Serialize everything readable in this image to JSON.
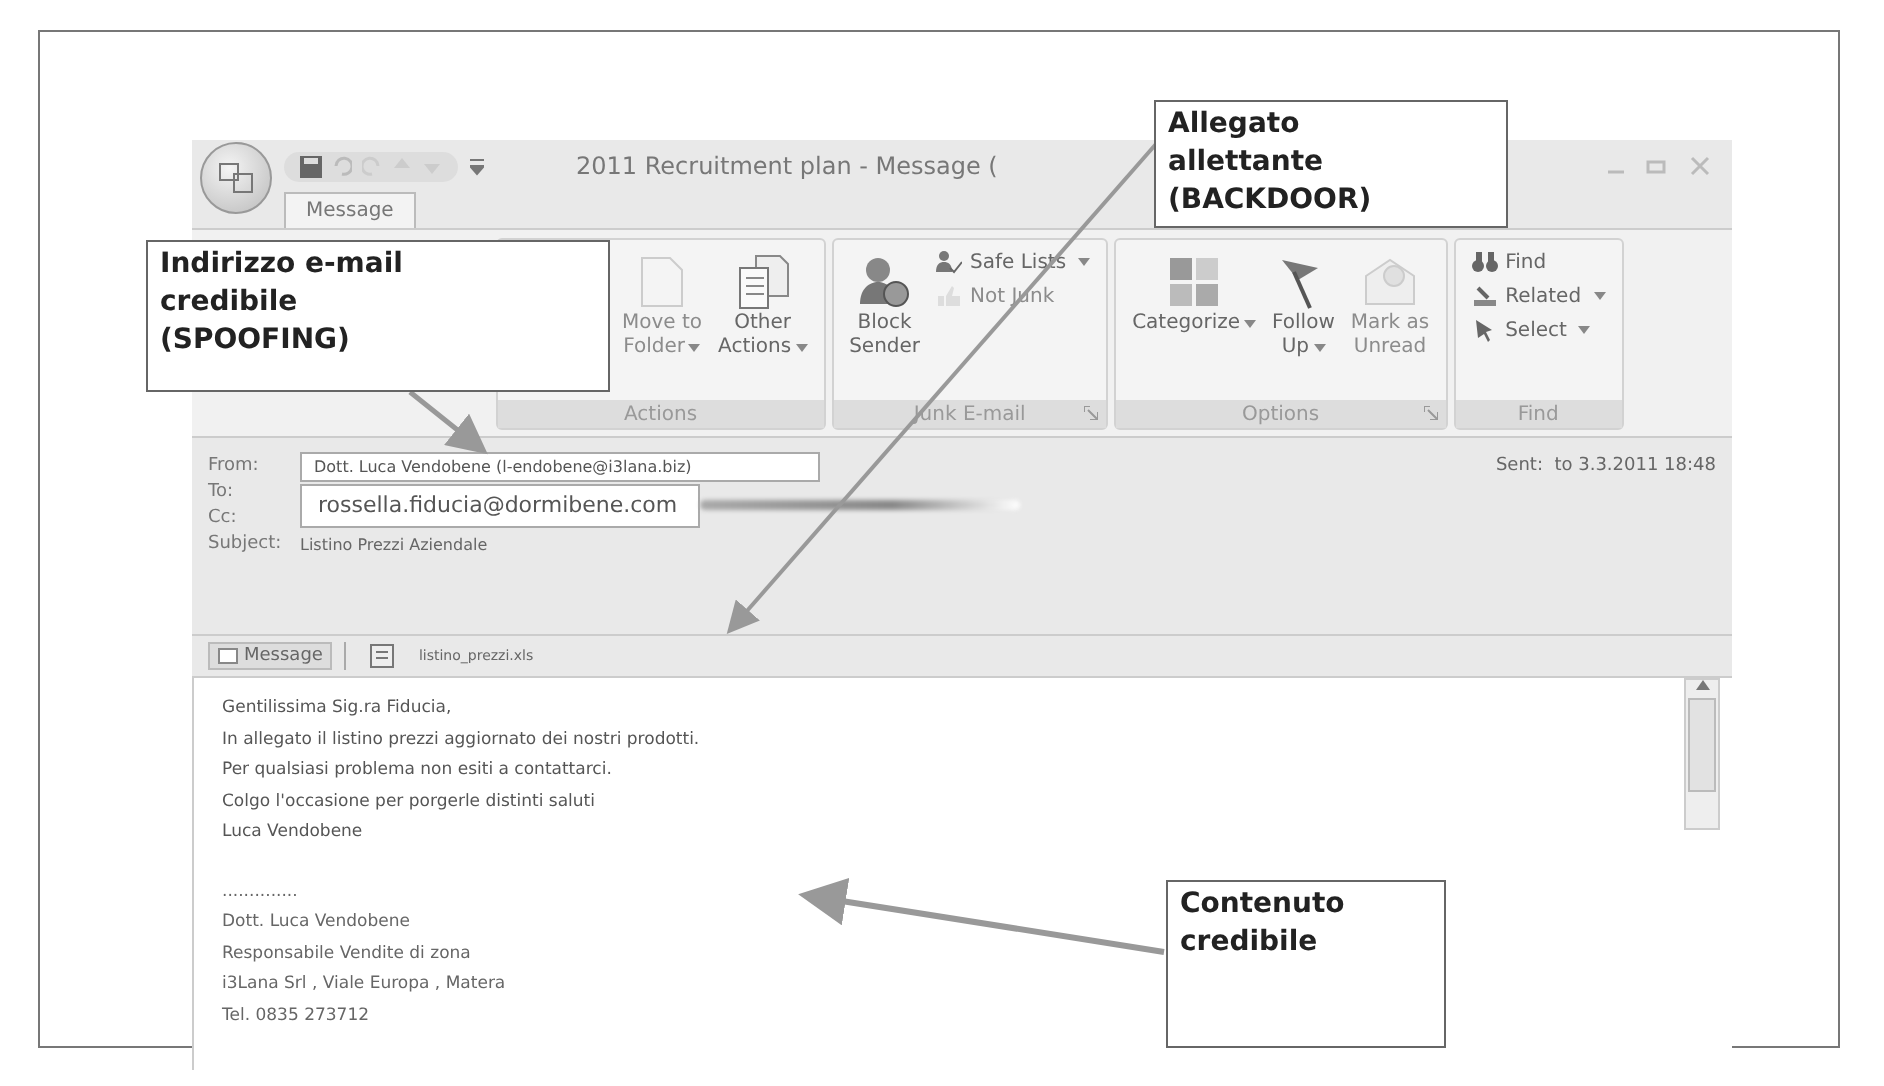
{
  "window": {
    "title": "2011 Recruitment plan - Message ("
  },
  "tabs": [
    {
      "label": "Message",
      "selected": true
    }
  ],
  "ribbon": [
    {
      "label": "Actions",
      "launcher": false,
      "buttons": [
        {
          "lines": [
            "Move to",
            "Folder"
          ],
          "dropdown": true,
          "disabled": true
        },
        {
          "lines": [
            "Other",
            "Actions"
          ],
          "dropdown": true,
          "disabled": false
        }
      ]
    },
    {
      "label": "Junk E-mail",
      "launcher": true,
      "buttons": [
        {
          "lines": [
            "Block",
            "Sender"
          ],
          "dropdown": false,
          "disabled": false,
          "kind": "large"
        },
        {
          "lines": [
            "Safe Lists"
          ],
          "dropdown": true,
          "disabled": false,
          "kind": "small"
        },
        {
          "lines": [
            "Not Junk"
          ],
          "dropdown": false,
          "disabled": true,
          "kind": "small"
        }
      ]
    },
    {
      "label": "Options",
      "launcher": true,
      "buttons": [
        {
          "lines": [
            "Categorize"
          ],
          "dropdown": true,
          "disabled": false
        },
        {
          "lines": [
            "Follow",
            "Up"
          ],
          "dropdown": true,
          "disabled": false
        },
        {
          "lines": [
            "Mark as",
            "Unread"
          ],
          "dropdown": false,
          "disabled": true
        }
      ]
    },
    {
      "label": "Find",
      "launcher": false,
      "buttons": [
        {
          "lines": [
            "Find"
          ],
          "dropdown": false,
          "disabled": false,
          "kind": "small"
        },
        {
          "lines": [
            "Related"
          ],
          "dropdown": true,
          "disabled": false,
          "kind": "small"
        },
        {
          "lines": [
            "Select"
          ],
          "dropdown": true,
          "disabled": false,
          "kind": "small"
        }
      ]
    }
  ],
  "header": {
    "from_label": "From:",
    "from": "Dott. Luca Vendobene (l-endobene@i3lana.biz)",
    "to_label": "To:",
    "to": "rossella.fiducia@dormibene.com",
    "cc_label": "Cc:",
    "subject_label": "Subject:",
    "subject": "Listino Prezzi Aziendale",
    "sent_label": "Sent:",
    "sent": "to 3.3.2011 18:48"
  },
  "attachments": {
    "message_tab": "Message",
    "file": "listino_prezzi.xls"
  },
  "body": [
    "Gentilissima Sig.ra Fiducia,",
    "In allegato il listino prezzi aggiornato dei nostri prodotti.",
    "Per qualsiasi problema non esiti a contattarci.",
    "Colgo l'occasione per porgerle distinti saluti",
    "Luca Vendobene"
  ],
  "signature": [
    "..............",
    "Dott. Luca Vendobene",
    "Responsabile Vendite di zona",
    "i3Lana Srl , Viale Europa , Matera",
    "Tel. 0835 273712"
  ],
  "callouts": [
    {
      "lines": [
        "Indirizzo e-mail",
        "credibile",
        "(SPOOFING)"
      ]
    },
    {
      "lines": [
        "Allegato",
        "allettante",
        "(BACKDOOR)"
      ]
    },
    {
      "lines": [
        "Contenuto",
        "credibile"
      ]
    }
  ]
}
